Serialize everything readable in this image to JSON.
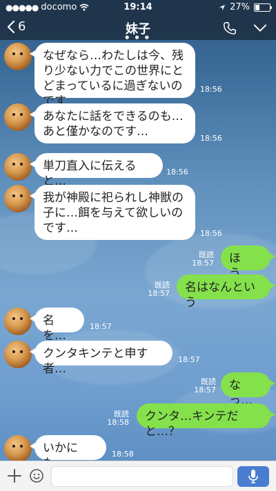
{
  "status_bar": {
    "carrier": "docomo",
    "time": "19:14",
    "battery_text": "27%"
  },
  "header": {
    "back_count": "6",
    "title": "妹子"
  },
  "messages": [
    {
      "side": "left",
      "text": "なぜなら…わたしは今、残り少ない力でこの世界にとどまっているに過ぎないのです…",
      "time": "18:56",
      "read": ""
    },
    {
      "side": "left",
      "text": "あなたに話をできるのも…あと僅かなのです…",
      "time": "18:56",
      "read": ""
    },
    {
      "side": "left",
      "text": "単刀直入に伝えると…",
      "time": "18:56",
      "read": ""
    },
    {
      "side": "left",
      "text": "我が神殿に祀られし神獣の子に…餌を与えて欲しいのです…",
      "time": "18:56",
      "read": ""
    },
    {
      "side": "right",
      "text": "ほう。",
      "time": "18:57",
      "read": "既読"
    },
    {
      "side": "right",
      "text": "名はなんという",
      "time": "18:57",
      "read": "既読"
    },
    {
      "side": "left",
      "text": "名を…",
      "time": "18:57",
      "read": ""
    },
    {
      "side": "left",
      "text": "クンタキンテと申す者…",
      "time": "18:57",
      "read": ""
    },
    {
      "side": "right",
      "text": "なっ…",
      "time": "18:57",
      "read": "既読"
    },
    {
      "side": "right",
      "text": "クンタ…キンテだと…？",
      "time": "18:58",
      "read": "既読"
    },
    {
      "side": "left",
      "text": "いかにも…",
      "time": "18:58",
      "read": ""
    }
  ],
  "colors": {
    "outgoing_bubble": "#84e14b",
    "incoming_bubble": "#ffffff",
    "header_bg": "#1e3246",
    "send_button": "#4a7ccf"
  }
}
